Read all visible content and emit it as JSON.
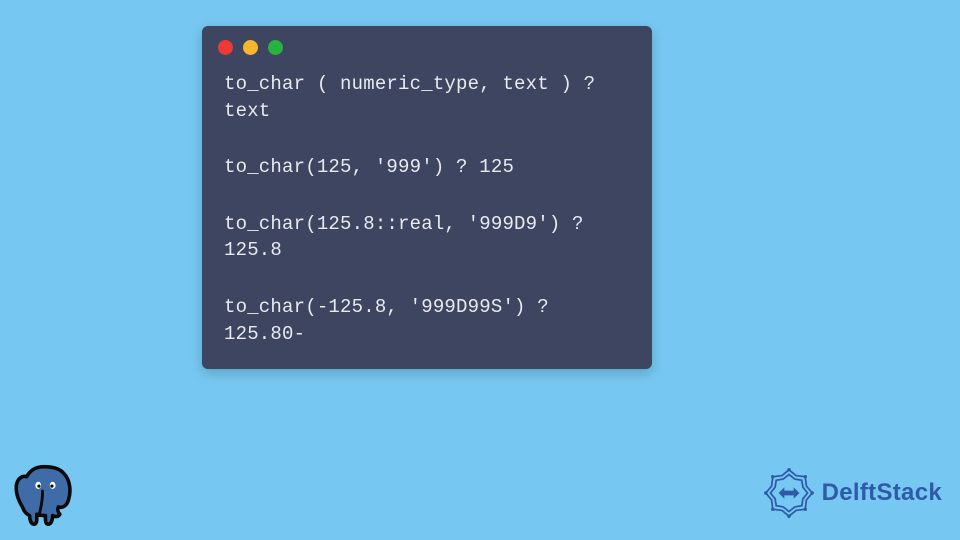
{
  "code": {
    "lines": [
      "to_char ( numeric_type, text ) ? text",
      "to_char(125, '999') ? 125",
      "to_char(125.8::real, '999D9') ? 125.8",
      "to_char(-125.8, '999D99S') ? 125.80-"
    ]
  },
  "brand": {
    "name": "DelftStack"
  },
  "colors": {
    "background": "#76c8f2",
    "window": "#3d4560",
    "text": "#e8eaf0",
    "brand": "#2f5aa8"
  }
}
